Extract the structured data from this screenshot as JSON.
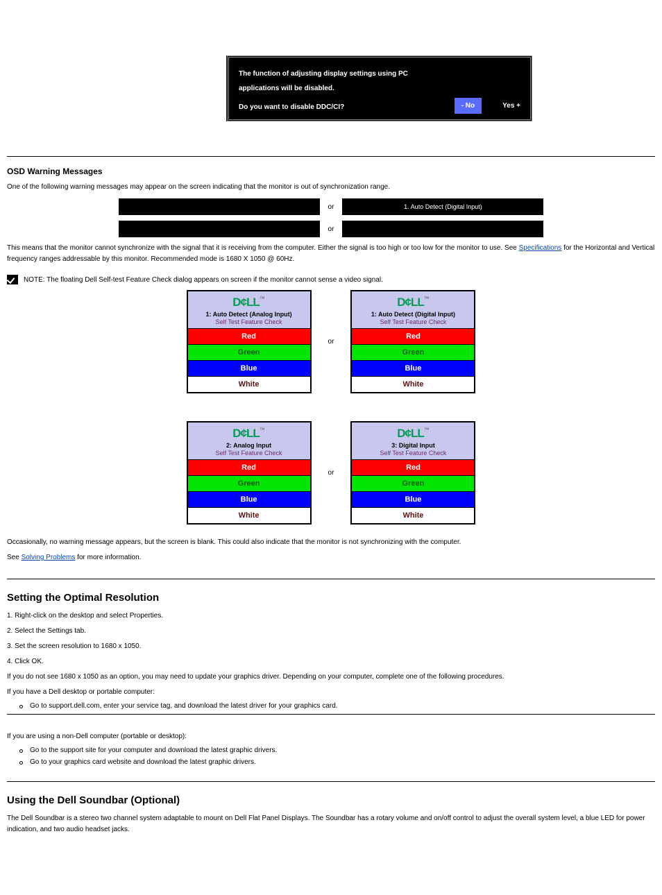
{
  "dialog": {
    "line1": "The function of adjusting display settings using PC",
    "line2": "applications will be disabled.",
    "question": "Do you want to disable DDC/CI?",
    "no": "- No",
    "yes": "Yes +"
  },
  "warning_heading": "OSD Warning Messages",
  "warning_intro": "One of the following warning messages may appear on the screen indicating that the monitor is out of synchronization range.",
  "black_pairs": {
    "row1_right": "1. Auto Detect  (Digital Input)",
    "or": "or"
  },
  "sync_para": "This means that the monitor cannot synchronize with the signal that it is receiving from the computer. Either the signal is too high or too low for the monitor to use.  See ",
  "spec_link": "Specifications",
  "sync_para_tail": " for the Horizontal and Vertical frequency ranges addressable by this monitor. Recommended mode is 1680 X 1050 @ 60Hz.",
  "note_text": "NOTE: The floating Dell Self-test Feature Check dialog appears on screen if the monitor cannot sense a video signal.",
  "stfc": {
    "logo": "D¢LL",
    "tm": "™",
    "red": "Red",
    "green": "Green",
    "blue": "Blue",
    "white": "White",
    "sub": "Self Test  Feature Check",
    "or": "or",
    "t1a": "1: Auto Detect (Analog Input)",
    "t1b": "1: Auto Detect (Digital Input)",
    "t2a": "2: Analog Input",
    "t2b": "3: Digital Input"
  },
  "occasional_para": "Occasionally, no warning message appears, but the screen is blank.  This could also indicate that the monitor is not synchronizing with the computer.",
  "see_solving": "See ",
  "solving_link": "Solving Problems",
  "see_solving_tail": " for more information.",
  "opt_res": {
    "heading": "Setting the Optimal Resolution",
    "step1": "1. Right-click on the desktop and select Properties.",
    "step2": "2. Select the Settings tab.",
    "step3": "3. Set the screen resolution to 1680 x 1050.",
    "step4": "4. Click OK.",
    "no_option": "If you do not see 1680 x 1050 as an option, you may need to update your graphics driver. Depending on your computer, complete one of the following procedures.",
    "dell_line": "If you have a Dell desktop or portable computer:",
    "bullet_a": "Go to support.dell.com, enter your service tag, and download the latest driver for your graphics card.",
    "nondell_line": "If you are using a non-Dell computer (portable or desktop):",
    "bullet_b": "Go to the support site for your computer and download the latest graphic drivers.",
    "bullet_c": "Go to your graphics card website and download the latest graphic drivers."
  },
  "soundbar": {
    "heading": "Using the Dell Soundbar (Optional)",
    "para": "The Dell Soundbar is a stereo two channel system adaptable to mount on Dell Flat Panel Displays.  The Soundbar has a rotary volume and on/off control to adjust the overall system level, a blue LED for power indication, and two audio headset jacks."
  }
}
